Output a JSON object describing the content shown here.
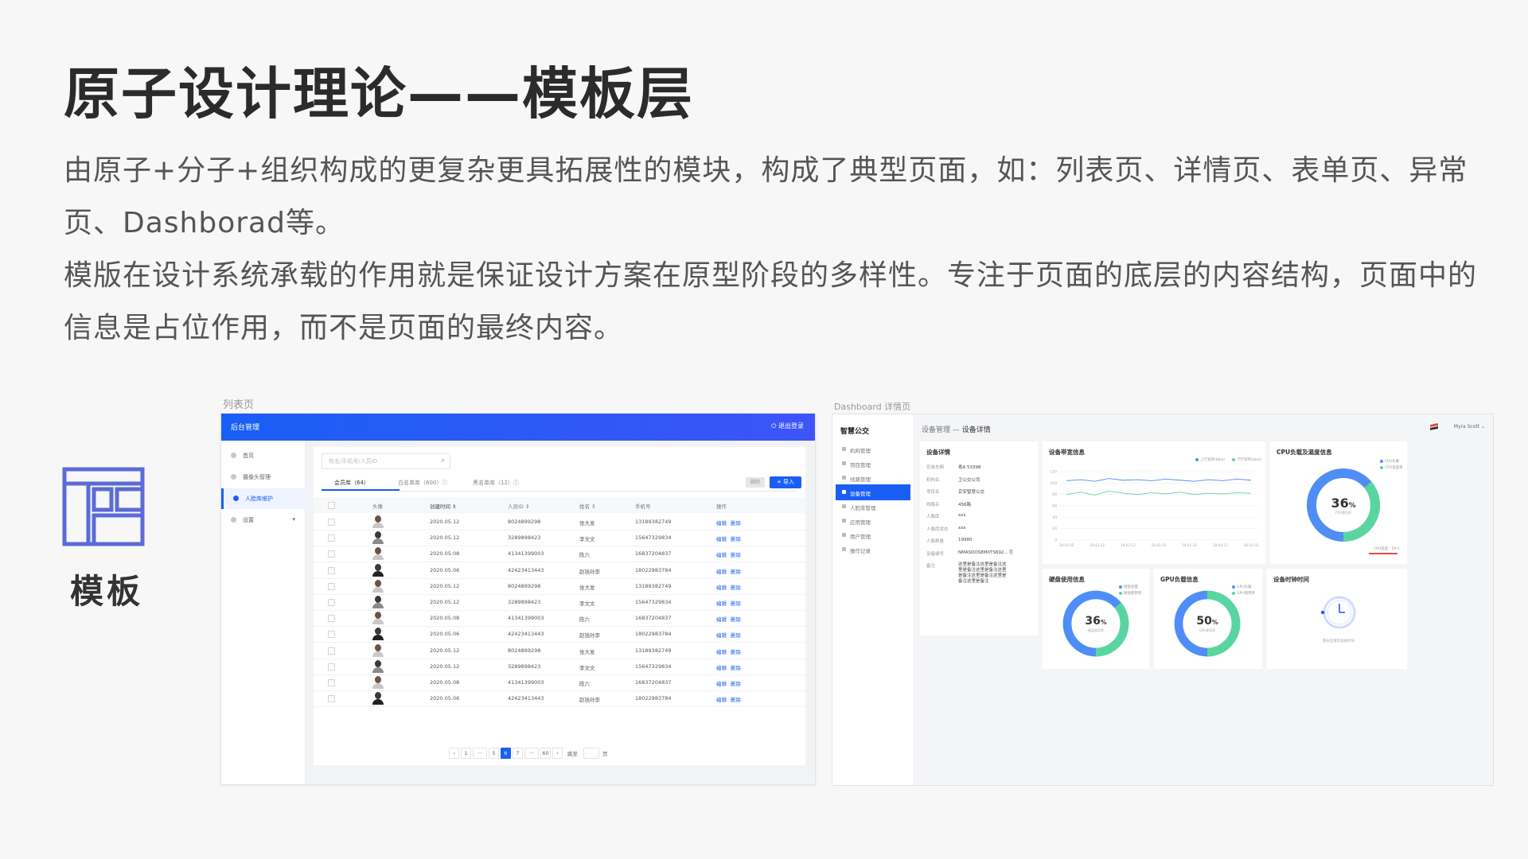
{
  "slide": {
    "title": "原子设计理论——模板层",
    "paragraph_1": "由原子+分子+组织构成的更复杂更具拓展性的模块，构成了典型页面，如：列表页、详情页、表单页、异常页、Dashborad等。",
    "paragraph_2": "模版在设计系统承载的作用就是保证设计方案在原型阶段的多样性。专注于页面的底层的内容结构，页面中的信息是占位作用，而不是页面的最终内容。",
    "template_label": "模板",
    "template_icon": "template-layout-icon",
    "accent_color": "#5b6bd6"
  },
  "list_page": {
    "caption": "列表页",
    "topbar_title": "后台管理",
    "logout": "⏻ 退出登录",
    "sidebar": [
      {
        "label": "首页"
      },
      {
        "label": "摄像头管理"
      },
      {
        "label": "人脸库维护",
        "active": true
      },
      {
        "label": "设置",
        "chevron": "▾"
      }
    ],
    "search_placeholder": "姓名/手机号/人员ID",
    "tabs": [
      {
        "label": "会员库（64）",
        "active": true
      },
      {
        "label": "白名单库（600）ⓘ"
      },
      {
        "label": "黑名单库（12）ⓘ"
      }
    ],
    "delete_btn": "删除",
    "import_btn": "+ 导入",
    "columns": [
      "头像",
      "创建时间 ⇕",
      "人员ID ⇕",
      "姓名 ⇕",
      "手机号",
      "操作"
    ],
    "rows": [
      {
        "date": "2020.05.12",
        "id": "8024899298",
        "name": "张大发",
        "phone": "13189382749"
      },
      {
        "date": "2020.05.12",
        "id": "3289898423",
        "name": "李文文",
        "phone": "15647329834"
      },
      {
        "date": "2020.05.08",
        "id": "41341399003",
        "name": "陈六",
        "phone": "16837204837"
      },
      {
        "date": "2020.05.06",
        "id": "42423413443",
        "name": "赵钱孙李",
        "phone": "18022983784"
      },
      {
        "date": "2020.05.12",
        "id": "8024899298",
        "name": "张大发",
        "phone": "13189382749"
      },
      {
        "date": "2020.05.12",
        "id": "3289898423",
        "name": "李文文",
        "phone": "15647329834"
      },
      {
        "date": "2020.05.08",
        "id": "41341399003",
        "name": "陈六",
        "phone": "16837204837"
      },
      {
        "date": "2020.05.06",
        "id": "42423413443",
        "name": "赵钱孙李",
        "phone": "18022983784"
      },
      {
        "date": "2020.05.12",
        "id": "8024899298",
        "name": "张大发",
        "phone": "13189382749"
      },
      {
        "date": "2020.05.12",
        "id": "3289898423",
        "name": "李文文",
        "phone": "15647329834"
      },
      {
        "date": "2020.05.08",
        "id": "41341399003",
        "name": "陈六",
        "phone": "16837204837"
      },
      {
        "date": "2020.05.06",
        "id": "42423413443",
        "name": "赵钱孙李",
        "phone": "18022983784"
      }
    ],
    "action_edit": "编辑",
    "action_delete": "删除",
    "pagination": {
      "prev": "‹",
      "pages": [
        "1",
        "···",
        "5",
        "6",
        "7",
        "···",
        "60"
      ],
      "current": "6",
      "next": "›",
      "goto": "跳至",
      "page_unit": "页"
    }
  },
  "dashboard": {
    "caption": "Dashboard 详情页",
    "brand": "智慧公交",
    "sidebar": [
      {
        "label": "机构管理"
      },
      {
        "label": "项目管理"
      },
      {
        "label": "线路管理"
      },
      {
        "label": "设备管理",
        "active": true
      },
      {
        "label": "人脸库管理"
      },
      {
        "label": "应用管理"
      },
      {
        "label": "用户管理"
      },
      {
        "label": "操作记录"
      }
    ],
    "breadcrumb_parent": "设备管理",
    "breadcrumb_sep": " — ",
    "breadcrumb_current": "设备详情",
    "user": "Myra Scott ⌄",
    "detail_card": {
      "title": "设备详情",
      "rows": [
        {
          "k": "安装车辆",
          "v": "粤A 53398"
        },
        {
          "k": "机构名",
          "v": "卫公交公司"
        },
        {
          "k": "项目名",
          "v": "京安智慧公交"
        },
        {
          "k": "线路名",
          "v": "456路"
        },
        {
          "k": "人像库",
          "v": "xxx"
        },
        {
          "k": "人像库状态",
          "v": "xxx"
        },
        {
          "k": "人像数量",
          "v": "19980"
        },
        {
          "k": "设备编号",
          "v": "NMASDOS8MXTS692...  ⎘"
        },
        {
          "k": "备注",
          "v": "这里是备注这里是备注这里是备注这里是备注这里是备注这里是备注这里是备注这里是备注"
        }
      ]
    },
    "bandwidth_card": {
      "title": "设备带宽信息",
      "legend": [
        "上行宽带(kb/s)",
        "下行宽带(kb/s)"
      ],
      "yticks": [
        "120",
        "100",
        "80",
        "60",
        "40",
        "20",
        "0"
      ],
      "xticks": [
        "18:42:32",
        "18:42:32",
        "18:42:12",
        "18:42:32",
        "18:42:32",
        "18:42:12",
        "18:42:32"
      ],
      "series_up": [
        104,
        106,
        103,
        108,
        105,
        106,
        104,
        107,
        105,
        103,
        106,
        104,
        107,
        105
      ],
      "series_down": [
        80,
        84,
        79,
        86,
        82,
        80,
        83,
        81,
        84,
        80,
        82,
        81,
        83,
        82
      ],
      "ymax": 120
    },
    "cpu_card": {
      "title": "CPU负载及温度信息",
      "value": 36,
      "unit": "%",
      "sub": "CPU使用率",
      "legend": [
        "CPU负载",
        "CPU温度率"
      ],
      "temp": "CPU温度：39℃"
    },
    "disk_card": {
      "title": "硬盘使用信息",
      "value": 36,
      "unit": "%",
      "sub": "硬盘使用率",
      "legend": [
        "硬盘容量",
        "硬盘使用率"
      ]
    },
    "gpu_card": {
      "title": "GPU负载信息",
      "value": 50,
      "unit": "%",
      "sub": "GPU使用率",
      "legend": [
        "GPU负载",
        "GPU使用率"
      ]
    },
    "clock_card": {
      "title": "设备时钟时间",
      "icon": "clock-icon",
      "sub": "暂未连接到设备时间"
    },
    "colors": {
      "primary": "#1a5ff5",
      "green": "#59d6a0",
      "blue_light": "#4f8ef7",
      "red": "#e5484d"
    }
  }
}
